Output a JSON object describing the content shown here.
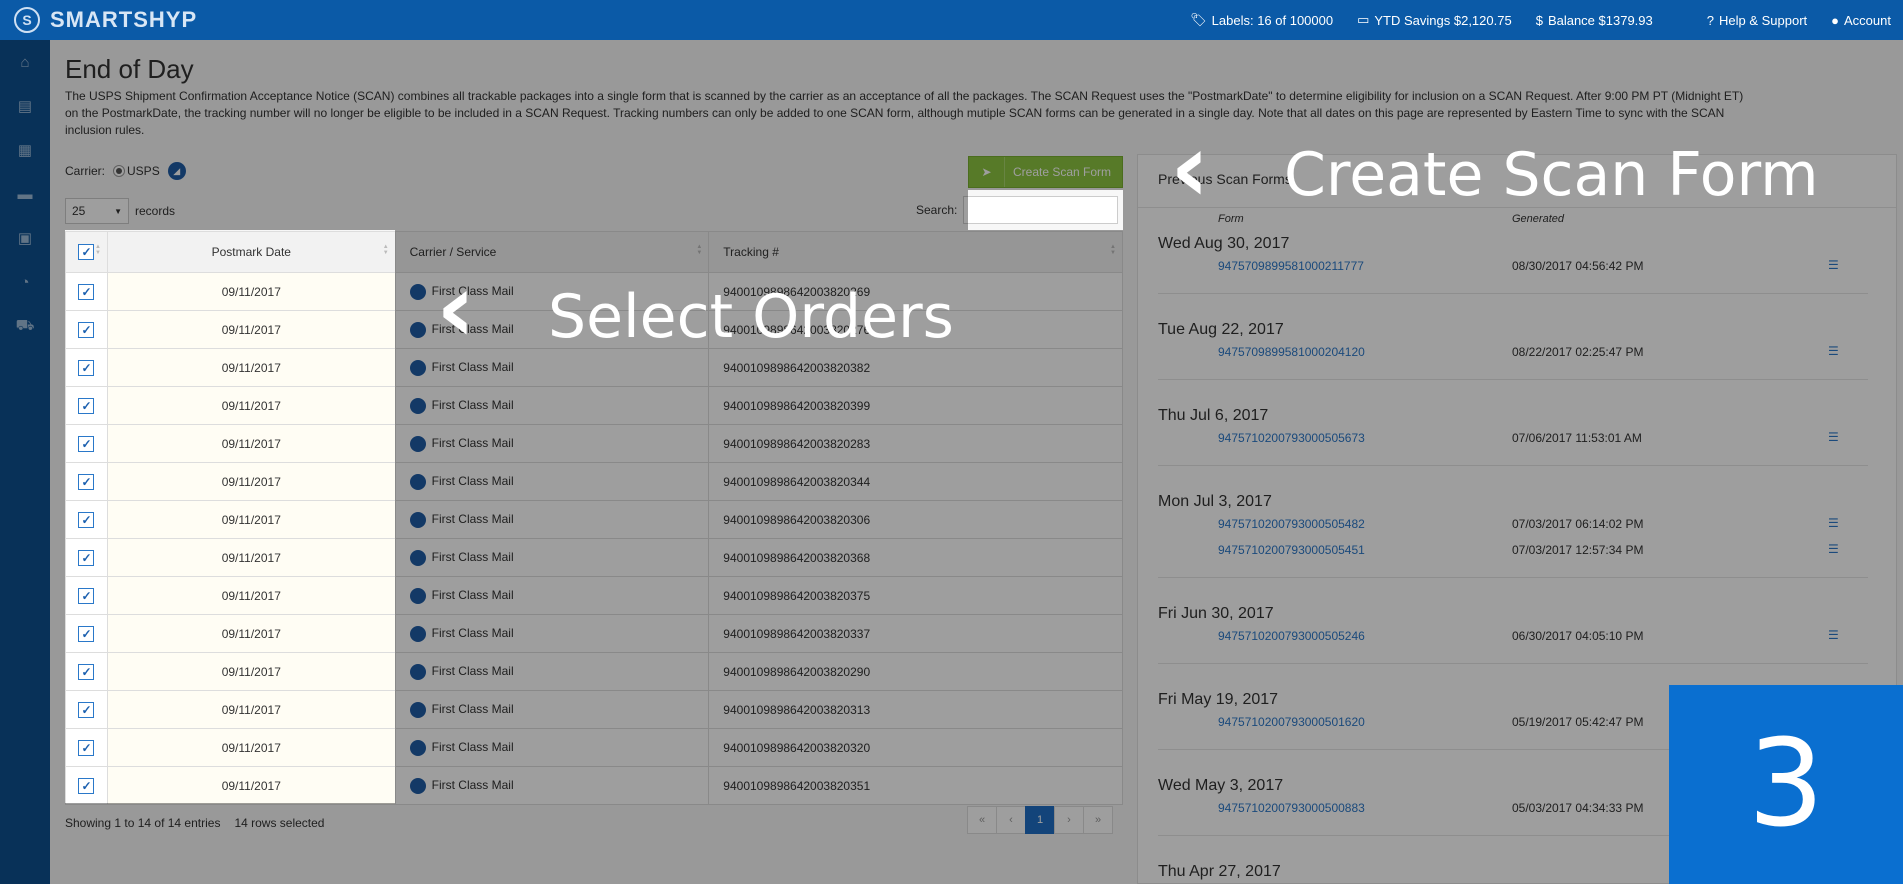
{
  "topbar": {
    "brand": "SMARTSHYP",
    "labels": "Labels: 16 of 100000",
    "ytd": "YTD Savings $2,120.75",
    "balance": "Balance $1379.93",
    "help": "Help & Support",
    "account": "Account"
  },
  "page": {
    "title": "End of Day",
    "description": "The USPS Shipment Confirmation Acceptance Notice (SCAN) combines all trackable packages into a single form that is scanned by the carrier as an acceptance of all the packages. The SCAN Request uses the \"PostmarkDate\" to determine eligibility for inclusion on a SCAN Request. After 9:00 PM PT (Midnight ET) on the PostmarkDate, the tracking number will no longer be eligible to be included in a SCAN Request. Tracking numbers can only be added to one SCAN form, although mutiple SCAN forms can be generated in a single day. Note that all dates on this page are represented by Eastern Time to sync with the SCAN inclusion rules."
  },
  "controls": {
    "carrier_label": "Carrier:",
    "carrier_value": "USPS",
    "create_button": "Create Scan Form",
    "length_value": "25",
    "records_label": "records",
    "search_label": "Search:"
  },
  "table": {
    "headers": [
      "Postmark Date",
      "Carrier / Service",
      "Tracking #"
    ],
    "rows": [
      {
        "date": "09/11/2017",
        "service": "First Class Mail",
        "tracking": "9400109898642003820269"
      },
      {
        "date": "09/11/2017",
        "service": "First Class Mail",
        "tracking": "9400109898642003820276"
      },
      {
        "date": "09/11/2017",
        "service": "First Class Mail",
        "tracking": "9400109898642003820382"
      },
      {
        "date": "09/11/2017",
        "service": "First Class Mail",
        "tracking": "9400109898642003820399"
      },
      {
        "date": "09/11/2017",
        "service": "First Class Mail",
        "tracking": "9400109898642003820283"
      },
      {
        "date": "09/11/2017",
        "service": "First Class Mail",
        "tracking": "9400109898642003820344"
      },
      {
        "date": "09/11/2017",
        "service": "First Class Mail",
        "tracking": "9400109898642003820306"
      },
      {
        "date": "09/11/2017",
        "service": "First Class Mail",
        "tracking": "9400109898642003820368"
      },
      {
        "date": "09/11/2017",
        "service": "First Class Mail",
        "tracking": "9400109898642003820375"
      },
      {
        "date": "09/11/2017",
        "service": "First Class Mail",
        "tracking": "9400109898642003820337"
      },
      {
        "date": "09/11/2017",
        "service": "First Class Mail",
        "tracking": "9400109898642003820290"
      },
      {
        "date": "09/11/2017",
        "service": "First Class Mail",
        "tracking": "9400109898642003820313"
      },
      {
        "date": "09/11/2017",
        "service": "First Class Mail",
        "tracking": "9400109898642003820320"
      },
      {
        "date": "09/11/2017",
        "service": "First Class Mail",
        "tracking": "9400109898642003820351"
      }
    ],
    "info": "Showing 1 to 14 of 14 entries",
    "selected": "14 rows selected",
    "pager": [
      "«",
      "‹",
      "1",
      "›",
      "»"
    ]
  },
  "previous": {
    "title": "Previous Scan Forms",
    "col_form": "Form",
    "col_generated": "Generated",
    "groups": [
      {
        "date": "Wed Aug 30, 2017",
        "items": [
          {
            "num": "9475709899581000211777",
            "gen": "08/30/2017 04:56:42 PM"
          }
        ]
      },
      {
        "date": "Tue Aug 22, 2017",
        "items": [
          {
            "num": "9475709899581000204120",
            "gen": "08/22/2017 02:25:47 PM"
          }
        ]
      },
      {
        "date": "Thu Jul 6, 2017",
        "items": [
          {
            "num": "9475710200793000505673",
            "gen": "07/06/2017 11:53:01 AM"
          }
        ]
      },
      {
        "date": "Mon Jul 3, 2017",
        "items": [
          {
            "num": "9475710200793000505482",
            "gen": "07/03/2017 06:14:02 PM"
          },
          {
            "num": "9475710200793000505451",
            "gen": "07/03/2017 12:57:34 PM"
          }
        ]
      },
      {
        "date": "Fri Jun 30, 2017",
        "items": [
          {
            "num": "9475710200793000505246",
            "gen": "06/30/2017 04:05:10 PM"
          }
        ]
      },
      {
        "date": "Fri May 19, 2017",
        "items": [
          {
            "num": "9475710200793000501620",
            "gen": "05/19/2017 05:42:47 PM"
          }
        ]
      },
      {
        "date": "Wed May 3, 2017",
        "items": [
          {
            "num": "9475710200793000500883",
            "gen": "05/03/2017 04:34:33 PM"
          }
        ]
      },
      {
        "date": "Thu Apr 27, 2017",
        "items": []
      }
    ]
  },
  "annotations": {
    "create": "Create Scan Form",
    "select": "Select Orders",
    "step": "3"
  },
  "icons": {
    "brand": "shield-s-icon",
    "labels": "tag-icon",
    "ytd": "money-icon",
    "balance": "dollar-icon",
    "help": "question-circle-icon",
    "account": "user-circle-icon"
  },
  "colors": {
    "topbar": "#0b5aa7",
    "sidebar": "#0d4f8f",
    "accent_green": "#8dc641",
    "link_blue": "#2d78c8",
    "step_blue": "#0a6fd0"
  }
}
